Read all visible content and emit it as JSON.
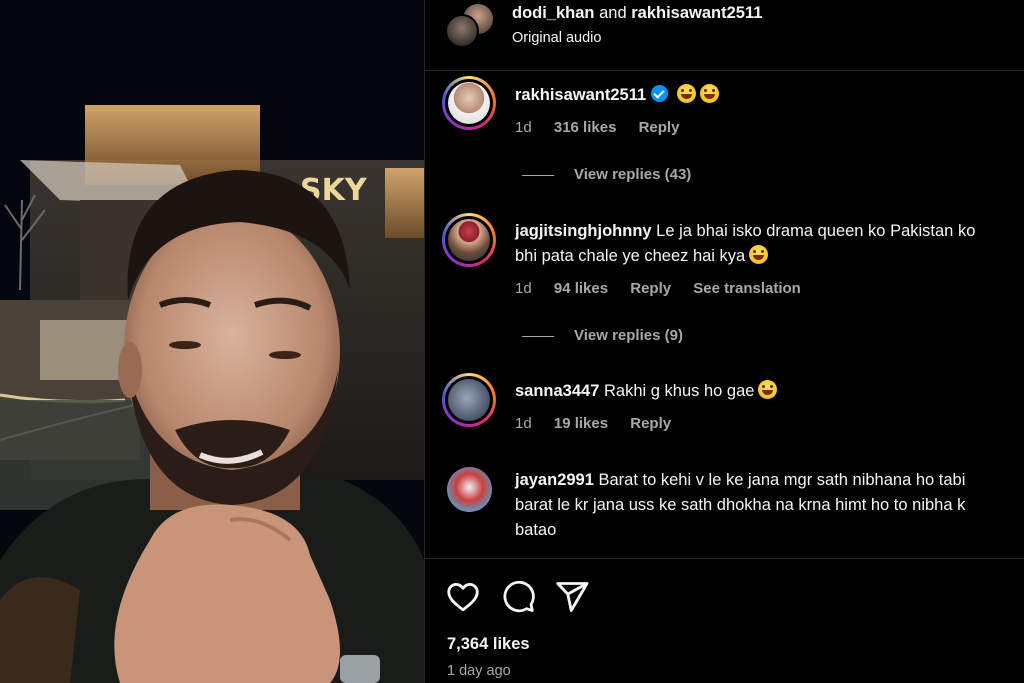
{
  "header": {
    "user1": "dodi_khan",
    "and_text": "and",
    "user2": "rakhisawant2511",
    "subtitle": "Original audio"
  },
  "media": {
    "sign_text": "SKY"
  },
  "comments": [
    {
      "username": "rakhisawant2511",
      "verified": true,
      "text": "",
      "emoji_count": 2,
      "time": "1d",
      "likes": "316 likes",
      "reply": "Reply",
      "view_replies": "View replies (43)"
    },
    {
      "username": "jagjitsinghjohnny",
      "line1": "Le ja bhai isko drama queen ko Pakistan ko",
      "line2": "bhi pata chale ye cheez hai kya",
      "time": "1d",
      "likes": "94 likes",
      "reply": "Reply",
      "translation": "See translation",
      "view_replies": "View replies (9)"
    },
    {
      "username": "sanna3447",
      "text": "Rakhi g khus ho gae",
      "time": "1d",
      "likes": "19 likes",
      "reply": "Reply"
    },
    {
      "username": "jayan2991",
      "line1": "Barat to kehi v le ke jana mgr sath nibhana ho tabi",
      "line2": "barat le kr jana uss ke sath dhokha na krna himt ho to nibha k",
      "line3": "batao"
    }
  ],
  "actions": {
    "icons": [
      "heart-icon",
      "comment-icon",
      "share-icon"
    ],
    "likes_count": "7,364 likes",
    "time_ago": "1 day ago"
  }
}
